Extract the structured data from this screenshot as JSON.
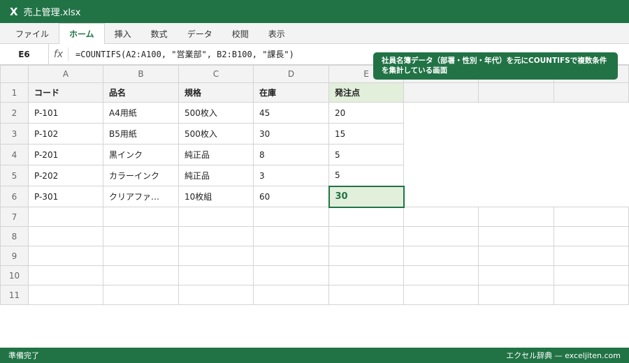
{
  "app": {
    "logo": "X",
    "filename": "売上管理.xlsx"
  },
  "ribbon": {
    "tabs": [
      "ファイル",
      "ホーム",
      "挿入",
      "数式",
      "データ",
      "校閲",
      "表示"
    ],
    "active_index": 1
  },
  "formula_bar": {
    "name_box": "E6",
    "fx": "fx",
    "formula": "=COUNTIFS(A2:A100, \"営業部\", B2:B100, \"課長\")"
  },
  "callout": "社員名簿データ（部署・性別・年代）を元にCOUNTIFSで複数条件を集計している画面",
  "columns": [
    "A",
    "B",
    "C",
    "D",
    "E",
    "",
    "",
    ""
  ],
  "row_numbers": [
    "1",
    "2",
    "3",
    "4",
    "5",
    "6",
    "7",
    "8",
    "9",
    "10",
    "11"
  ],
  "header": [
    "コード",
    "品名",
    "規格",
    "在庫",
    "発注点"
  ],
  "rows": [
    [
      "P-101",
      "A4用紙",
      "500枚入",
      "45",
      "20"
    ],
    [
      "P-102",
      "B5用紙",
      "500枚入",
      "30",
      "15"
    ],
    [
      "P-201",
      "黒インク",
      "純正品",
      "8",
      "5"
    ],
    [
      "P-202",
      "カラーインク",
      "純正品",
      "3",
      "5"
    ],
    [
      "P-301",
      "クリアファ…",
      "10枚組",
      "60",
      "30"
    ]
  ],
  "selected_cell": "E6",
  "status": {
    "left": "準備完了",
    "right": "エクセル辞典 — exceljiten.com"
  },
  "colors": {
    "accent": "#217346",
    "highlight": "#e2efda"
  }
}
